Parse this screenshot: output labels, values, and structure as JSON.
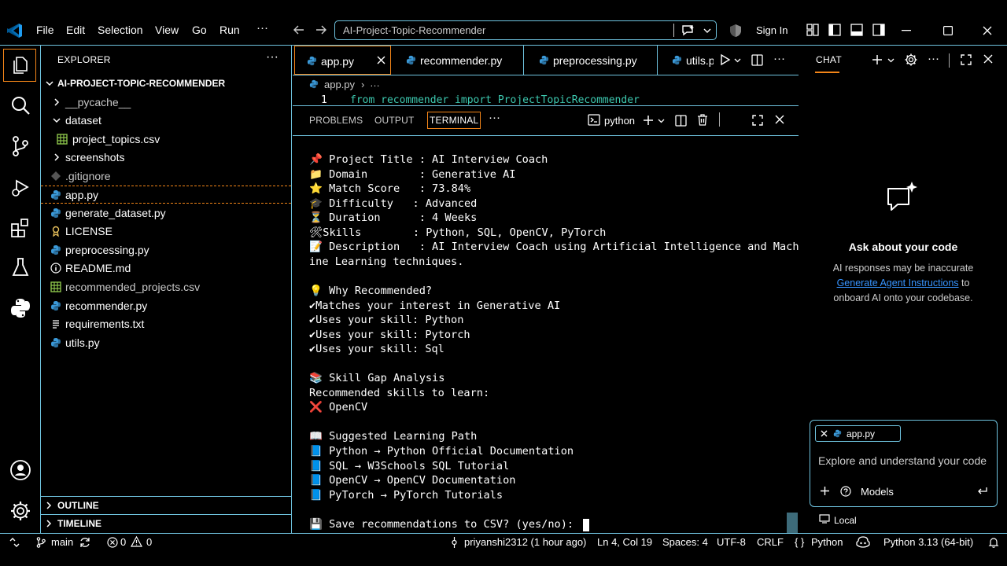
{
  "titlebar": {
    "menus": [
      "File",
      "Edit",
      "Selection",
      "View",
      "Go",
      "Run"
    ],
    "more": "···",
    "search_text": "AI-Project-Topic-Recommender",
    "sign_in": "Sign In"
  },
  "sidebar": {
    "title": "EXPLORER",
    "more": "···",
    "root": "AI-PROJECT-TOPIC-RECOMMENDER",
    "items": [
      {
        "label": "__pycache__",
        "kind": "folder-collapsed",
        "depth": 1
      },
      {
        "label": "dataset",
        "kind": "folder-expanded",
        "depth": 1
      },
      {
        "label": "project_topics.csv",
        "kind": "csv",
        "depth": 2
      },
      {
        "label": "screenshots",
        "kind": "folder-collapsed",
        "depth": 1
      },
      {
        "label": ".gitignore",
        "kind": "gitignore",
        "depth": 1
      },
      {
        "label": "app.py",
        "kind": "python",
        "depth": 1
      },
      {
        "label": "generate_dataset.py",
        "kind": "python",
        "depth": 1
      },
      {
        "label": "LICENSE",
        "kind": "license",
        "depth": 1
      },
      {
        "label": "preprocessing.py",
        "kind": "python",
        "depth": 1
      },
      {
        "label": "README.md",
        "kind": "info",
        "depth": 1
      },
      {
        "label": "recommended_projects.csv",
        "kind": "csv",
        "depth": 1
      },
      {
        "label": "recommender.py",
        "kind": "python",
        "depth": 1
      },
      {
        "label": "requirements.txt",
        "kind": "text",
        "depth": 1
      },
      {
        "label": "utils.py",
        "kind": "python",
        "depth": 1
      }
    ],
    "outline": "OUTLINE",
    "timeline": "TIMELINE"
  },
  "editor": {
    "tabs": [
      "app.py",
      "recommender.py",
      "preprocessing.py",
      "utils.p"
    ],
    "breadcrumb_file": "app.py",
    "breadcrumb_more": "…",
    "line_number": "1",
    "code_line": "from recommender import ProjectTopicRecommender"
  },
  "panel": {
    "tabs": [
      "PROBLEMS",
      "OUTPUT",
      "TERMINAL"
    ],
    "more": "···",
    "shell": "python"
  },
  "terminal": {
    "lines": [
      "📌 Project Title : AI Interview Coach",
      "📁 Domain        : Generative AI",
      "⭐ Match Score   : 73.84%",
      "🎓 Difficulty   : Advanced",
      "⏳ Duration      : 4 Weeks",
      "🛠Skills        : Python, SQL, OpenCV, PyTorch",
      "📝 Description   : AI Interview Coach using Artificial Intelligence and Mach",
      "ine Learning techniques.",
      "",
      "💡 Why Recommended?",
      "✔Matches your interest in Generative AI",
      "✔Uses your skill: Python",
      "✔Uses your skill: Pytorch",
      "✔Uses your skill: Sql",
      "",
      "📚 Skill Gap Analysis",
      "Recommended skills to learn:",
      "❌ OpenCV",
      "",
      "📖 Suggested Learning Path",
      "📘 Python → Python Official Documentation",
      "📘 SQL → W3Schools SQL Tutorial",
      "📘 OpenCV → OpenCV Documentation",
      "📘 PyTorch → PyTorch Tutorials",
      "",
      "💾 Save recommendations to CSV? (yes/no): "
    ]
  },
  "chat": {
    "title": "CHAT",
    "more": "···",
    "heading": "Ask about your code",
    "line1": "AI responses may be inaccurate",
    "link": "Generate Agent Instructions",
    "line2_suffix": " to",
    "line3": "onboard AI onto your codebase.",
    "context_file": "app.py",
    "placeholder": "Explore and understand your code",
    "models": "Models",
    "local": "Local"
  },
  "statusbar": {
    "branch": "main",
    "errors": "0",
    "warnings": "0",
    "blame": "priyanshi2312 (1 hour ago)",
    "position": "Ln 4, Col 19",
    "spaces": "Spaces: 4",
    "encoding": "UTF-8",
    "eol": "CRLF",
    "language": "Python",
    "interpreter": "Python 3.13 (64-bit)"
  },
  "colors": {
    "border": "#6fc3df",
    "focus": "#f38518",
    "python_blue": "#3b9ad9",
    "csv_green": "#8bc34a"
  }
}
